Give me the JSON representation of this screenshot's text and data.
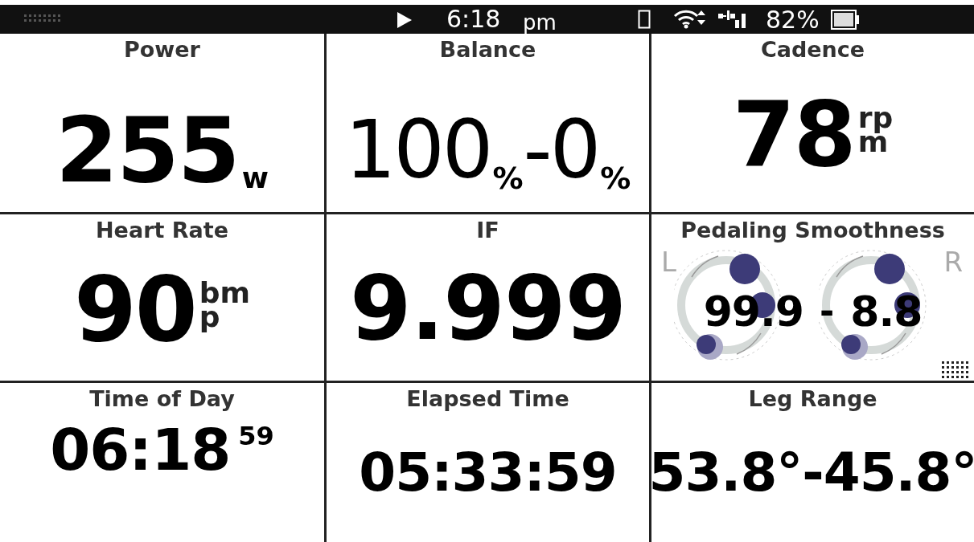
{
  "status_bar": {
    "time": "6:18",
    "meridiem": "pm",
    "battery": "82%"
  },
  "tiles": [
    {
      "kind": "unit_sub",
      "title": "Power",
      "value": "255",
      "unit": "w"
    },
    {
      "kind": "split",
      "title": "Balance",
      "parts": [
        {
          "value": "100",
          "unit": "%"
        },
        {
          "value": "-0",
          "unit": "%"
        }
      ]
    },
    {
      "kind": "unit_stack",
      "title": "Cadence",
      "value": "78",
      "unit_lines": [
        "rp",
        "m"
      ]
    },
    {
      "kind": "unit_stack",
      "title": "Heart Rate",
      "value": "90",
      "unit_lines": [
        "bm",
        "p"
      ]
    },
    {
      "kind": "plain",
      "title": "IF",
      "value": "9.999"
    },
    {
      "kind": "smoothness",
      "title": "Pedaling Smoothness",
      "left_label": "L",
      "right_label": "R",
      "left_value": "99.9",
      "separator": "-",
      "right_value": "8.8"
    },
    {
      "kind": "superscript",
      "title": "Time of Day",
      "value": "06:18",
      "sup": "59"
    },
    {
      "kind": "plain",
      "title": "Elapsed Time",
      "value": "05:33:59"
    },
    {
      "kind": "plain",
      "title": "Leg Range",
      "value": "53.8°-45.8°"
    }
  ]
}
